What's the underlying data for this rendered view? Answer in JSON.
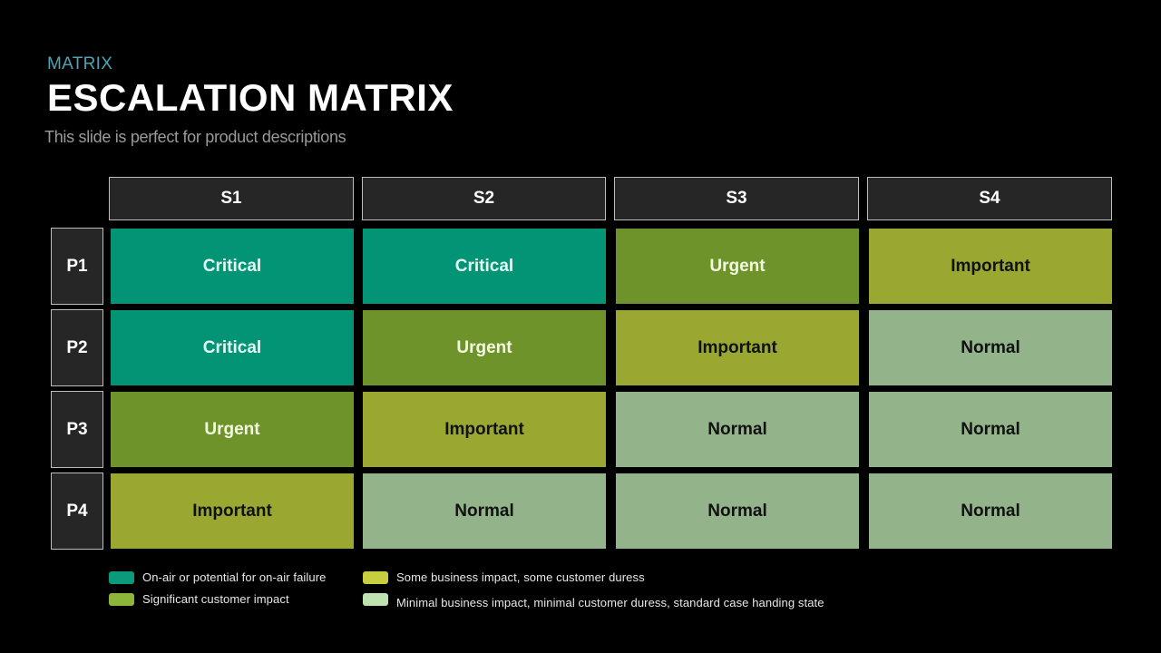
{
  "header": {
    "kicker": "MATRIX",
    "title": "ESCALATION MATRIX",
    "subtitle": "This slide is perfect for product descriptions"
  },
  "matrix": {
    "columns": [
      "S1",
      "S2",
      "S3",
      "S4"
    ],
    "rows": [
      {
        "label": "P1",
        "cells": [
          "Critical",
          "Critical",
          "Urgent",
          "Important"
        ]
      },
      {
        "label": "P2",
        "cells": [
          "Critical",
          "Urgent",
          "Important",
          "Normal"
        ]
      },
      {
        "label": "P3",
        "cells": [
          "Urgent",
          "Important",
          "Normal",
          "Normal"
        ]
      },
      {
        "label": "P4",
        "cells": [
          "Important",
          "Normal",
          "Normal",
          "Normal"
        ]
      }
    ],
    "level_colors": {
      "Critical": {
        "bg": "#039476",
        "fg": "#e6fbf4"
      },
      "Urgent": {
        "bg": "#6f932b",
        "fg": "#f2fbe0"
      },
      "Important": {
        "bg": "#9aa731",
        "fg": "#111111"
      },
      "Normal": {
        "bg": "#93b48a",
        "fg": "#111111"
      }
    }
  },
  "legend": [
    {
      "color": "#0b9a7c",
      "text": "On-air  or potential for on-air failure"
    },
    {
      "color": "#8db53a",
      "text": "Significant customer impact"
    },
    {
      "color": "#c7cf3f",
      "text": "Some business impact, some customer duress"
    },
    {
      "color": "#bfe3b0",
      "text": "Minimal business impact, minimal customer duress, standard case handing state"
    }
  ]
}
